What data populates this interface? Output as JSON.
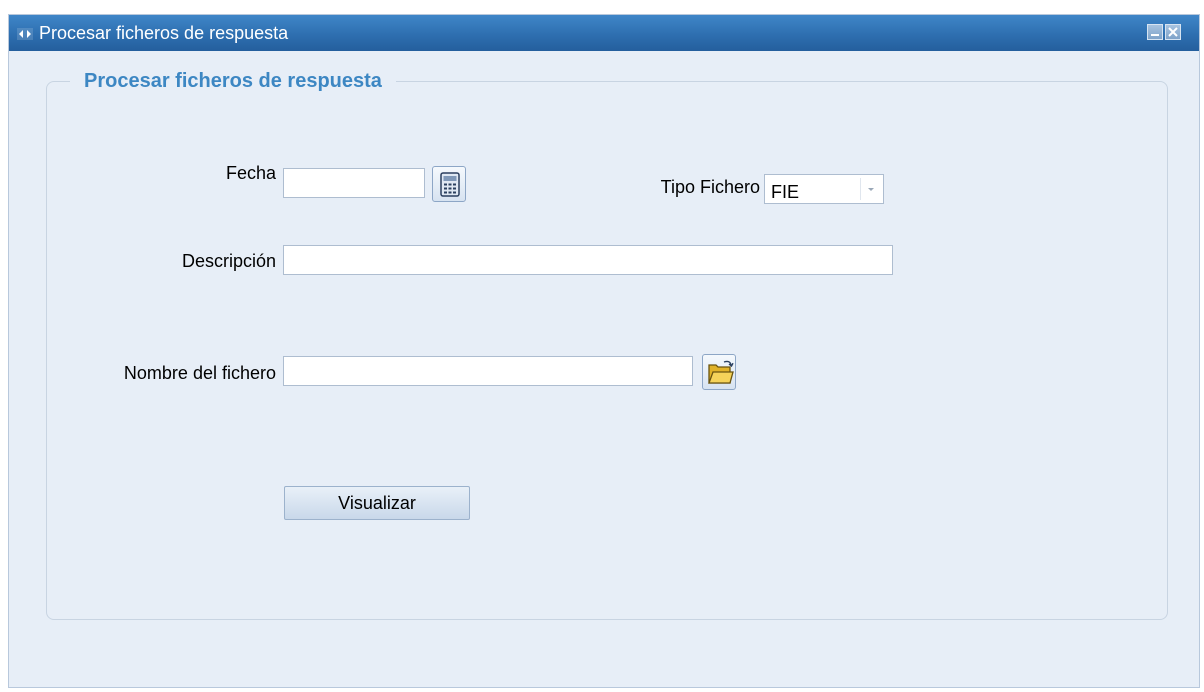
{
  "window": {
    "title": "Procesar ficheros de respuesta",
    "title_icon": "app-window-icon",
    "minimize_icon": "minimize-icon",
    "close_icon": "close-icon"
  },
  "form": {
    "group_title": "Procesar ficheros de respuesta",
    "fecha": {
      "label": "Fecha",
      "value": "",
      "calendar_icon": "calendar-icon"
    },
    "tipo_fichero": {
      "label": "Tipo Fichero",
      "selected": "FIE",
      "dropdown_icon": "chevron-down-icon"
    },
    "descripcion": {
      "label": "Descripción",
      "value": ""
    },
    "nombre_fichero": {
      "label": "Nombre del fichero",
      "value": "",
      "browse_icon": "folder-open-icon"
    },
    "visualizar_label": "Visualizar"
  },
  "colors": {
    "titlebar": "#2e6fb0",
    "background": "#e7eef7",
    "group_title": "#3d87c3"
  }
}
